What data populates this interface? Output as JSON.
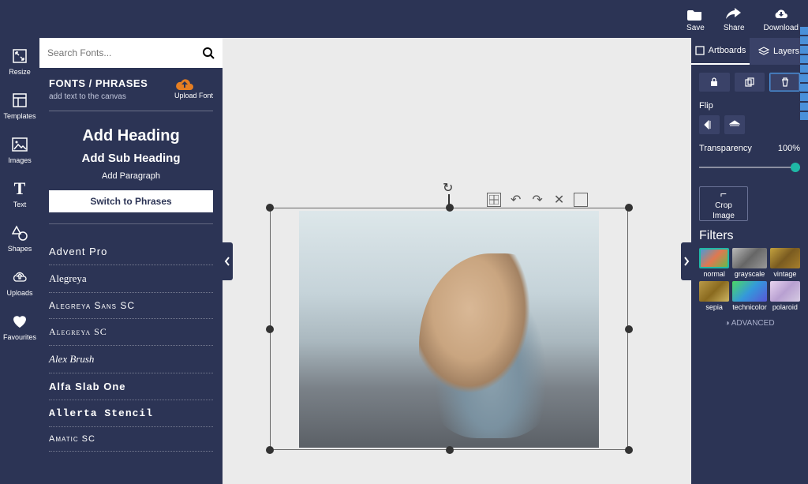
{
  "topnav": {
    "save": "Save",
    "share": "Share",
    "download": "Download"
  },
  "sidebar": {
    "items": [
      {
        "label": "Resize",
        "icon": "resize-icon"
      },
      {
        "label": "Templates",
        "icon": "templates-icon"
      },
      {
        "label": "Images",
        "icon": "images-icon"
      },
      {
        "label": "Text",
        "icon": "text-icon"
      },
      {
        "label": "Shapes",
        "icon": "shapes-icon"
      },
      {
        "label": "Uploads",
        "icon": "uploads-icon"
      },
      {
        "label": "Favourites",
        "icon": "favourites-icon"
      }
    ]
  },
  "search": {
    "placeholder": "Search Fonts..."
  },
  "panel": {
    "title": "FONTS / PHRASES",
    "subtitle": "add text to the canvas",
    "upload_label": "Upload Font",
    "presets": {
      "heading": "Add Heading",
      "subheading": "Add Sub Heading",
      "paragraph": "Add Paragraph"
    },
    "switch_button": "Switch to Phrases",
    "fonts": [
      "Advent Pro",
      "Alegreya",
      "Alegreya Sans SC",
      "Alegreya SC",
      "Alex Brush",
      "Alfa Slab One",
      "Allerta Stencil",
      "Amatic SC"
    ]
  },
  "right": {
    "tabs": {
      "artboards": "Artboards",
      "layers": "Layers"
    },
    "flip_label": "Flip",
    "transparency_label": "Transparency",
    "transparency_value": "100%",
    "crop_line1": "Crop",
    "crop_line2": "Image",
    "filters_label": "Filters",
    "filters": [
      "normal",
      "grayscale",
      "vintage",
      "sepia",
      "technicolor",
      "polaroid"
    ],
    "advanced": "ADVANCED"
  }
}
